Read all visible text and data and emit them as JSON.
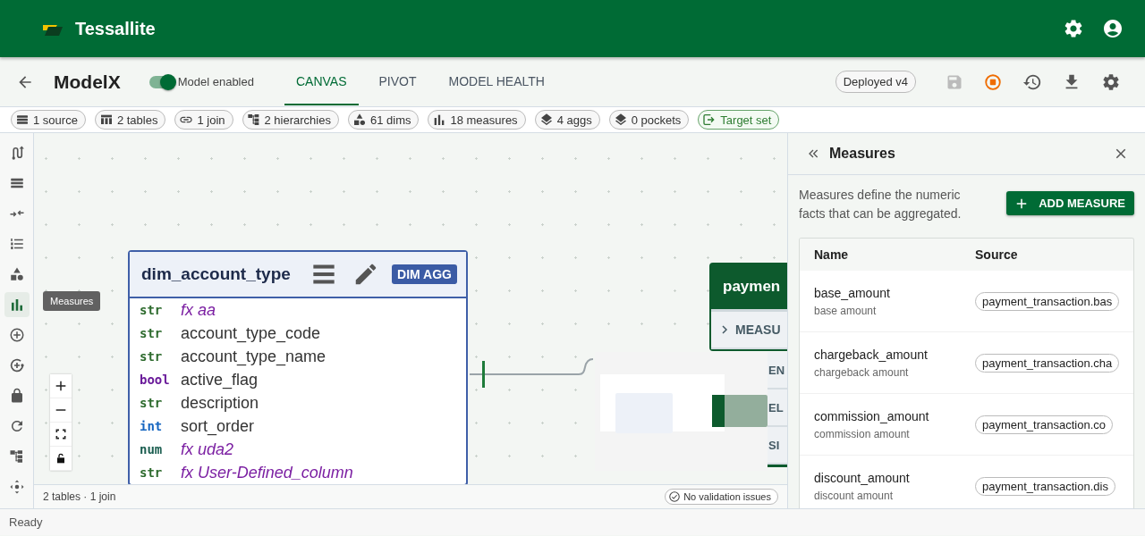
{
  "app": {
    "title": "Tessallite"
  },
  "model": {
    "name": "ModelX",
    "enabled": true,
    "enabled_label": "Model enabled"
  },
  "tabs": [
    {
      "label": "CANVAS",
      "selected": true
    },
    {
      "label": "PIVOT",
      "selected": false
    },
    {
      "label": "MODEL HEALTH",
      "selected": false
    }
  ],
  "deploy_status": "Deployed v4",
  "save_disabled": true,
  "stats": [
    {
      "label": "1 source",
      "kind": "count"
    },
    {
      "label": "2 tables",
      "kind": "count"
    },
    {
      "label": "1 join",
      "kind": "count"
    },
    {
      "label": "2 hierarchies",
      "kind": "count"
    },
    {
      "label": "61 dims",
      "kind": "count"
    },
    {
      "label": "18 measures",
      "kind": "count"
    },
    {
      "label": "4 aggs",
      "kind": "count"
    },
    {
      "label": "0 pockets",
      "kind": "count"
    },
    {
      "label": "Target set",
      "kind": "target"
    }
  ],
  "rail": [
    {
      "selected": false
    },
    {
      "selected": false
    },
    {
      "selected": false
    },
    {
      "selected": false
    },
    {
      "selected": false
    },
    {
      "selected": true
    },
    {
      "selected": false
    },
    {
      "selected": false
    },
    {
      "selected": false
    },
    {
      "selected": false
    },
    {
      "selected": false
    },
    {
      "selected": false
    }
  ],
  "tooltip": "Measures",
  "canvas": {
    "table": {
      "name": "dim_account_type",
      "badge": "DIM AGG",
      "columns": [
        {
          "type": "str",
          "color": "#2e6b2e",
          "name": "fx aa",
          "computed": true
        },
        {
          "type": "str",
          "color": "#2e6b2e",
          "name": "account_type_code",
          "computed": false
        },
        {
          "type": "str",
          "color": "#2e6b2e",
          "name": "account_type_name",
          "computed": false
        },
        {
          "type": "bool",
          "color": "#6a1b9a",
          "name": "active_flag",
          "computed": false
        },
        {
          "type": "str",
          "color": "#2e6b2e",
          "name": "description",
          "computed": false
        },
        {
          "type": "int",
          "color": "#1565c0",
          "name": "sort_order",
          "computed": false
        },
        {
          "type": "num",
          "color": "#1b5e50",
          "name": "fx uda2",
          "computed": true
        },
        {
          "type": "str",
          "color": "#2e6b2e",
          "name": "fx User-Defined_column",
          "computed": true
        }
      ]
    },
    "fact_table": {
      "name": "paymen",
      "rows": [
        {
          "label": "MEASU",
          "expandable": true
        },
        {
          "label": "EN",
          "expandable": false
        },
        {
          "label": "EL",
          "expandable": false
        },
        {
          "label": "SI",
          "expandable": false
        }
      ]
    },
    "summary": "2 tables · 1 join",
    "validation": "No validation issues"
  },
  "panel": {
    "title": "Measures",
    "description": "Measures define the numeric facts that can be aggregated.",
    "add_button": "ADD MEASURE",
    "columns": [
      "Name",
      "Source"
    ],
    "rows": [
      {
        "name": "base_amount",
        "caption": "base amount",
        "source": "payment_transaction.bas"
      },
      {
        "name": "chargeback_amount",
        "caption": "chargeback amount",
        "source": "payment_transaction.cha"
      },
      {
        "name": "commission_amount",
        "caption": "commission amount",
        "source": "payment_transaction.co"
      },
      {
        "name": "discount_amount",
        "caption": "discount amount",
        "source": "payment_transaction.dis"
      }
    ]
  },
  "status_bar": "Ready"
}
